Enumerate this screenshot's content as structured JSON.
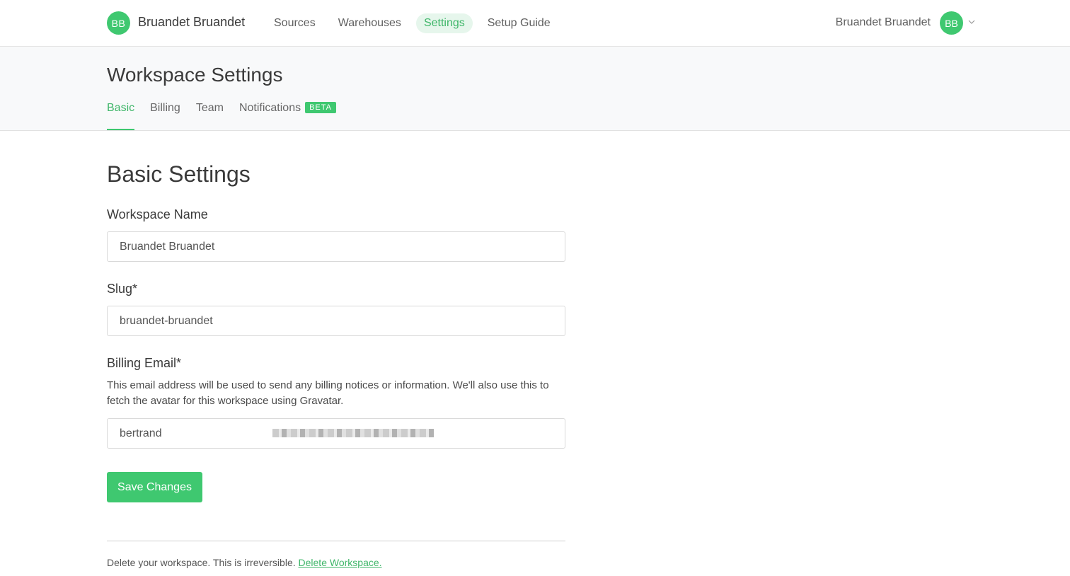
{
  "topnav": {
    "workspace_initials": "BB",
    "workspace_name": "Bruandet Bruandet",
    "links": [
      {
        "label": "Sources"
      },
      {
        "label": "Warehouses"
      },
      {
        "label": "Settings"
      },
      {
        "label": "Setup Guide"
      }
    ],
    "active_link": "Settings",
    "user_name": "Bruandet Bruandet",
    "user_initials": "BB"
  },
  "header": {
    "title": "Workspace Settings",
    "tabs": [
      {
        "label": "Basic"
      },
      {
        "label": "Billing"
      },
      {
        "label": "Team"
      },
      {
        "label": "Notifications",
        "badge": "BETA"
      }
    ],
    "active_tab": "Basic"
  },
  "form": {
    "section_title": "Basic Settings",
    "workspace_name_label": "Workspace Name",
    "workspace_name_value": "Bruandet Bruandet",
    "slug_label": "Slug*",
    "slug_value": "bruandet-bruandet",
    "billing_email_label": "Billing Email*",
    "billing_email_desc": "This email address will be used to send any billing notices or information. We'll also use this to fetch the avatar for this workspace using Gravatar.",
    "billing_email_value": "bertrand",
    "save_label": "Save Changes"
  },
  "danger": {
    "text": "Delete your workspace. This is irreversible.",
    "link": "Delete Workspace."
  },
  "colors": {
    "accent": "#3fc870",
    "accent_text": "#3fb669",
    "active_pill_bg": "#e6f6ec"
  }
}
